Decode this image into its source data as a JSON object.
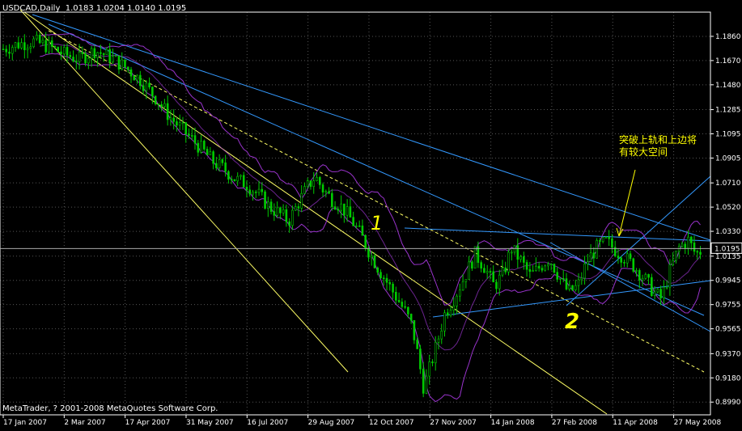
{
  "header": {
    "symbol": "USDCAD,Daily",
    "ohlc": "1.0183 1.0204 1.0140 1.0195"
  },
  "footer": {
    "copyright": "MetaTrader, ? 2001-2008 MetaQuotes Software Corp."
  },
  "annotation": {
    "note": "突破上轨和上边将有较大空间",
    "mark1": "1",
    "mark2": "2"
  },
  "colors": {
    "background": "#000000",
    "candle": "#00cc00",
    "band": "#9933cc",
    "trend_blue": "#3399ff",
    "trend_yellow": "#ffff66",
    "grid": "#555555",
    "text": "#ffffff"
  },
  "chart_data": {
    "type": "candlestick",
    "title": "USDCAD,Daily",
    "ylim": [
      0.889,
      1.205
    ],
    "y_ticks": [
      "1.1860",
      "1.1670",
      "1.1480",
      "1.1285",
      "1.1095",
      "1.0905",
      "1.0710",
      "1.0520",
      "1.0330",
      "1.0135",
      "0.9945",
      "0.9755",
      "0.9565",
      "0.9370",
      "0.9180",
      "0.8990"
    ],
    "x_ticks": [
      "17 Jan 2007",
      "2 Mar 2007",
      "17 Apr 2007",
      "31 May 2007",
      "16 Jul 2007",
      "29 Aug 2007",
      "12 Oct 2007",
      "27 Nov 2007",
      "14 Jan 2008",
      "27 Feb 2008",
      "11 Apr 2008",
      "27 May 2008"
    ],
    "current_price": "1.0195",
    "grid": true,
    "close_path": [
      [
        0,
        1.176
      ],
      [
        8,
        1.18
      ],
      [
        16,
        1.182
      ],
      [
        24,
        1.178
      ],
      [
        32,
        1.172
      ],
      [
        40,
        1.168
      ],
      [
        48,
        1.175
      ],
      [
        56,
        1.17
      ],
      [
        64,
        1.162
      ],
      [
        72,
        1.152
      ],
      [
        80,
        1.138
      ],
      [
        88,
        1.122
      ],
      [
        96,
        1.11
      ],
      [
        104,
        1.098
      ],
      [
        110,
        1.088
      ],
      [
        116,
        1.082
      ],
      [
        122,
        1.074
      ],
      [
        128,
        1.07
      ],
      [
        134,
        1.062
      ],
      [
        140,
        1.052
      ],
      [
        146,
        1.046
      ],
      [
        150,
        1.041
      ],
      [
        155,
        1.055
      ],
      [
        160,
        1.068
      ],
      [
        164,
        1.076
      ],
      [
        168,
        1.066
      ],
      [
        173,
        1.058
      ],
      [
        178,
        1.052
      ],
      [
        183,
        1.042
      ],
      [
        188,
        1.03
      ],
      [
        193,
        1.015
      ],
      [
        198,
        1.002
      ],
      [
        203,
        0.99
      ],
      [
        208,
        0.978
      ],
      [
        212,
        0.968
      ],
      [
        215,
        0.958
      ],
      [
        218,
        0.935
      ],
      [
        221,
        0.91
      ],
      [
        224,
        0.925
      ],
      [
        228,
        0.945
      ],
      [
        232,
        0.968
      ],
      [
        236,
        0.978
      ],
      [
        240,
        0.99
      ],
      [
        244,
        1.002
      ],
      [
        248,
        1.015
      ],
      [
        253,
        1.005
      ],
      [
        258,
        0.99
      ],
      [
        263,
        1.0
      ],
      [
        267,
        1.02
      ],
      [
        272,
        1.01
      ],
      [
        277,
        0.998
      ],
      [
        282,
        1.005
      ],
      [
        287,
        1.012
      ],
      [
        292,
        0.998
      ],
      [
        297,
        0.985
      ],
      [
        302,
        0.99
      ],
      [
        307,
        1.01
      ],
      [
        312,
        1.02
      ],
      [
        317,
        1.025
      ],
      [
        322,
        1.018
      ],
      [
        327,
        1.012
      ],
      [
        332,
        1.005
      ],
      [
        337,
        0.996
      ],
      [
        342,
        0.985
      ],
      [
        346,
        0.98
      ],
      [
        350,
        1.0
      ],
      [
        355,
        1.02
      ],
      [
        360,
        1.026
      ],
      [
        364,
        1.015
      ],
      [
        368,
        1.019
      ]
    ]
  }
}
